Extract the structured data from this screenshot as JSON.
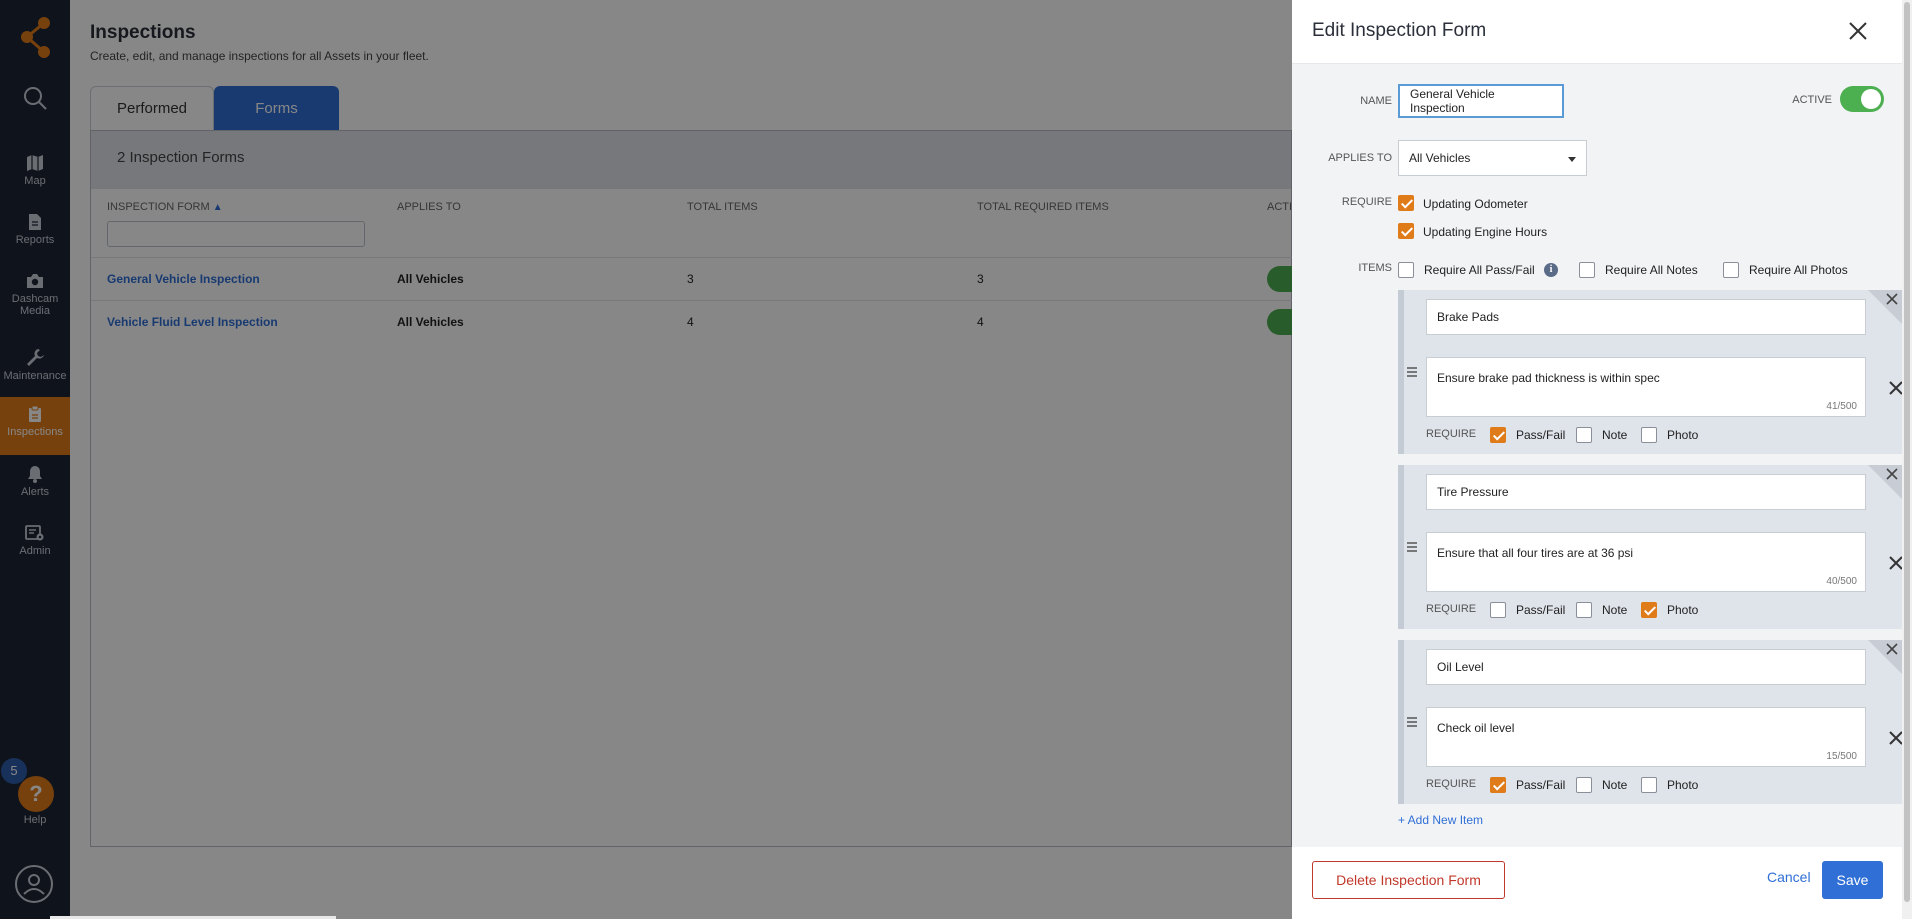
{
  "sidebar": {
    "items": [
      {
        "label": "Map"
      },
      {
        "label": "Reports"
      },
      {
        "label_line1": "Dashcam",
        "label_line2": "Media"
      },
      {
        "label": "Maintenance"
      },
      {
        "label": "Inspections"
      },
      {
        "label": "Alerts"
      },
      {
        "label": "Admin"
      }
    ],
    "help_badge": "5",
    "help_icon": "?",
    "help_label": "Help",
    "accent_color": "#e07b1a"
  },
  "page": {
    "title": "Inspections",
    "subtitle": "Create, edit, and manage inspections for all Assets in your fleet.",
    "tabs": [
      {
        "label": "Performed"
      },
      {
        "label": "Forms",
        "active": true
      }
    ]
  },
  "table": {
    "count_label": "2 Inspection Forms",
    "headers": [
      "INSPECTION FORM",
      "APPLIES TO",
      "TOTAL ITEMS",
      "TOTAL REQUIRED ITEMS",
      "ACTI"
    ],
    "rows": [
      {
        "name": "General Vehicle Inspection",
        "applies_to": "All Vehicles",
        "total_items": "3",
        "required_items": "3"
      },
      {
        "name": "Vehicle Fluid Level Inspection",
        "applies_to": "All Vehicles",
        "total_items": "4",
        "required_items": "4"
      }
    ]
  },
  "panel": {
    "title": "Edit Inspection Form",
    "name_label": "NAME",
    "name_value": "General Vehicle Inspection",
    "active_label": "ACTIVE",
    "active": true,
    "applies_label": "APPLIES TO",
    "applies_value": "All Vehicles",
    "require_label": "REQUIRE",
    "require_options": [
      {
        "label": "Updating Odometer",
        "checked": true
      },
      {
        "label": "Updating Engine Hours",
        "checked": true
      }
    ],
    "items_label": "ITEMS",
    "bulk_options": [
      {
        "label": "Require All Pass/Fail",
        "checked": false
      },
      {
        "label": "Require All Notes",
        "checked": false
      },
      {
        "label": "Require All Photos",
        "checked": false
      }
    ],
    "items": [
      {
        "name": "Brake Pads",
        "description": "Ensure brake pad thickness is within spec",
        "count": "41/500",
        "require_label": "REQUIRE",
        "pass_fail": true,
        "note": false,
        "photo": false
      },
      {
        "name": "Tire Pressure",
        "description": "Ensure that all four tires are at 36 psi",
        "count": "40/500",
        "require_label": "REQUIRE",
        "pass_fail": false,
        "note": false,
        "photo": true
      },
      {
        "name": "Oil Level",
        "description": "Check oil level",
        "count": "15/500",
        "require_label": "REQUIRE",
        "pass_fail": true,
        "note": false,
        "photo": false
      }
    ],
    "item_option_labels": {
      "pass_fail": "Pass/Fail",
      "note": "Note",
      "photo": "Photo"
    },
    "add_item": "+ Add New Item",
    "delete_button": "Delete Inspection Form",
    "cancel_button": "Cancel",
    "save_button": "Save"
  }
}
